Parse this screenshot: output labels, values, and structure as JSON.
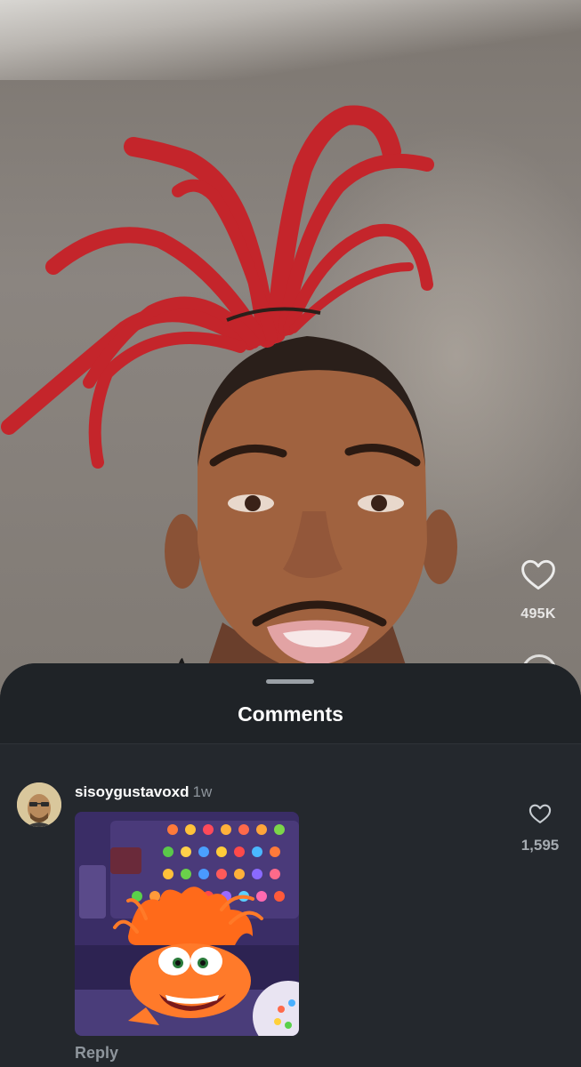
{
  "video": {
    "like_icon": "heart-outline-icon",
    "like_count": "495K"
  },
  "comments_sheet": {
    "title": "Comments",
    "comments": [
      {
        "username": "sisoygustavoxd",
        "time": "1w",
        "like_icon": "heart-outline-icon",
        "like_count": "1,595",
        "reply_label": "Reply"
      }
    ]
  },
  "colors": {
    "sheet_background": "#24282d",
    "header_background": "#1f2327",
    "muted_text": "#8e959c",
    "primary_text": "#ffffff"
  }
}
